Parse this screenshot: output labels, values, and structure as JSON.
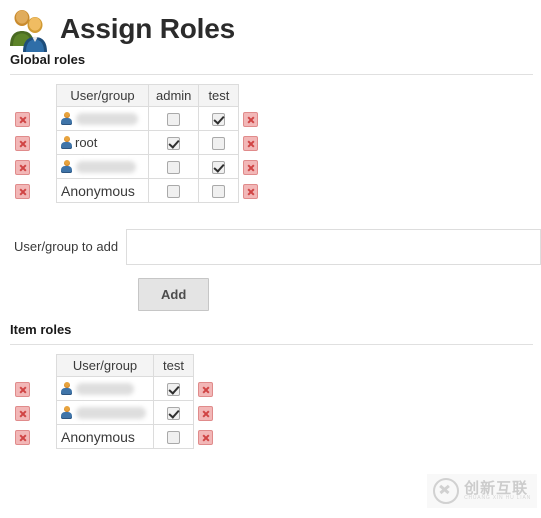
{
  "page": {
    "title": "Assign Roles",
    "title_icon": "people-icon"
  },
  "global_roles": {
    "heading": "Global roles",
    "columns": [
      "User/group",
      "admin",
      "test"
    ],
    "rows": [
      {
        "user": "",
        "redacted": true,
        "has_user_icon": true,
        "admin": false,
        "test": true,
        "delete_left_icon": "delete-icon",
        "delete_right_icon": "delete-icon"
      },
      {
        "user": "root",
        "redacted": false,
        "has_user_icon": true,
        "admin": true,
        "test": false,
        "delete_left_icon": "delete-icon",
        "delete_right_icon": "delete-icon"
      },
      {
        "user": "",
        "redacted": true,
        "has_user_icon": true,
        "admin": false,
        "test": true,
        "delete_left_icon": "delete-icon",
        "delete_right_icon": "delete-icon"
      },
      {
        "user": "Anonymous",
        "redacted": false,
        "has_user_icon": false,
        "admin": false,
        "test": false,
        "delete_left_icon": "delete-icon",
        "delete_right_icon": "delete-icon"
      }
    ]
  },
  "add_form": {
    "label": "User/group to add",
    "input_value": "",
    "input_placeholder": "",
    "button_label": "Add"
  },
  "item_roles": {
    "heading": "Item roles",
    "columns": [
      "User/group",
      "test"
    ],
    "rows": [
      {
        "user": "",
        "redacted": true,
        "has_user_icon": true,
        "test": true,
        "delete_left_icon": "delete-icon",
        "delete_right_icon": "delete-icon"
      },
      {
        "user": "",
        "redacted": true,
        "has_user_icon": true,
        "test": true,
        "delete_left_icon": "delete-icon",
        "delete_right_icon": "delete-icon"
      },
      {
        "user": "Anonymous",
        "redacted": false,
        "has_user_icon": false,
        "test": false,
        "delete_left_icon": "delete-icon",
        "delete_right_icon": "delete-icon"
      }
    ]
  },
  "watermark": {
    "cn": "创新互联",
    "en": "CHUANG XIN HU LIAN"
  },
  "colors": {
    "title": "#2b2b2b",
    "border": "#dcdcdc",
    "header_bg": "#f4f4f4",
    "delete_icon": "#d04444",
    "button_bg": "#e4e4e4"
  }
}
